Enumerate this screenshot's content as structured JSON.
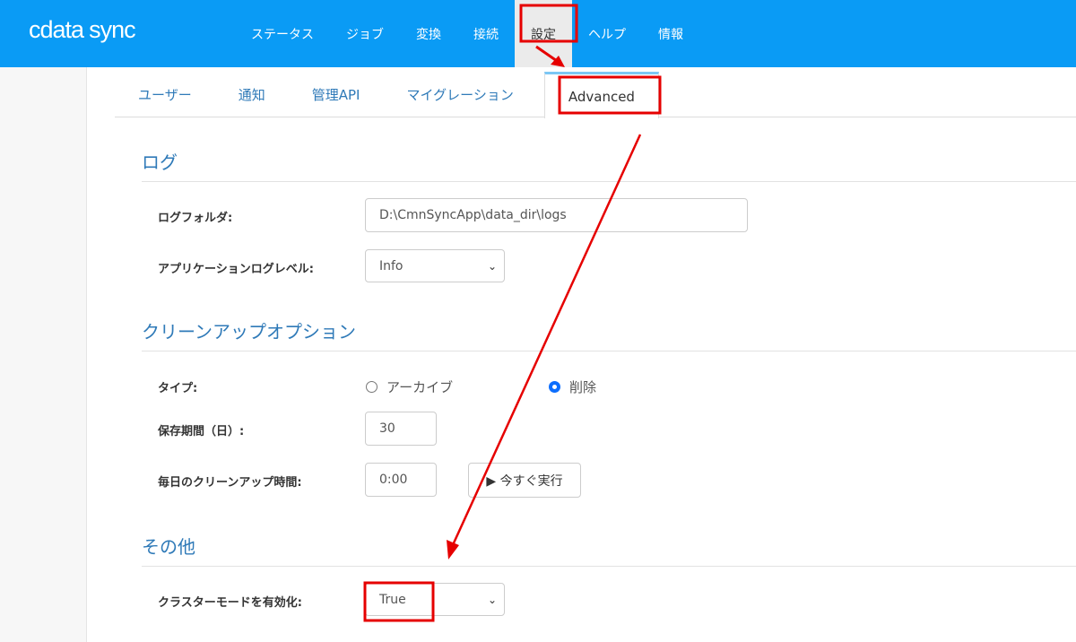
{
  "app": {
    "logo_brand": "cdata",
    "logo_product": "sync"
  },
  "nav": [
    "ステータス",
    "ジョブ",
    "変換",
    "接続",
    "設定",
    "ヘルプ",
    "情報"
  ],
  "tabs": [
    "ユーザー",
    "通知",
    "管理API",
    "マイグレーション",
    "Advanced"
  ],
  "log": {
    "title": "ログ",
    "folder_label": "ログフォルダ:",
    "folder_value": "D:\\CmnSyncApp\\data_dir\\logs",
    "level_label": "アプリケーションログレベル:",
    "level_value": "Info"
  },
  "cleanup": {
    "title": "クリーンアップオプション",
    "type_label": "タイプ:",
    "archive": "アーカイブ",
    "delete": "削除",
    "selected": "削除",
    "retention_label": "保存期間（日）:",
    "retention_value": "30",
    "time_label": "毎日のクリーンアップ時間:",
    "time_value": "0:00",
    "run_now": "▶ 今すぐ実行"
  },
  "other": {
    "title": "その他",
    "cluster_label": "クラスターモードを有効化:",
    "cluster_value": "True"
  },
  "colors": {
    "header": "#0a9bf5",
    "annotation": "#e60000"
  }
}
